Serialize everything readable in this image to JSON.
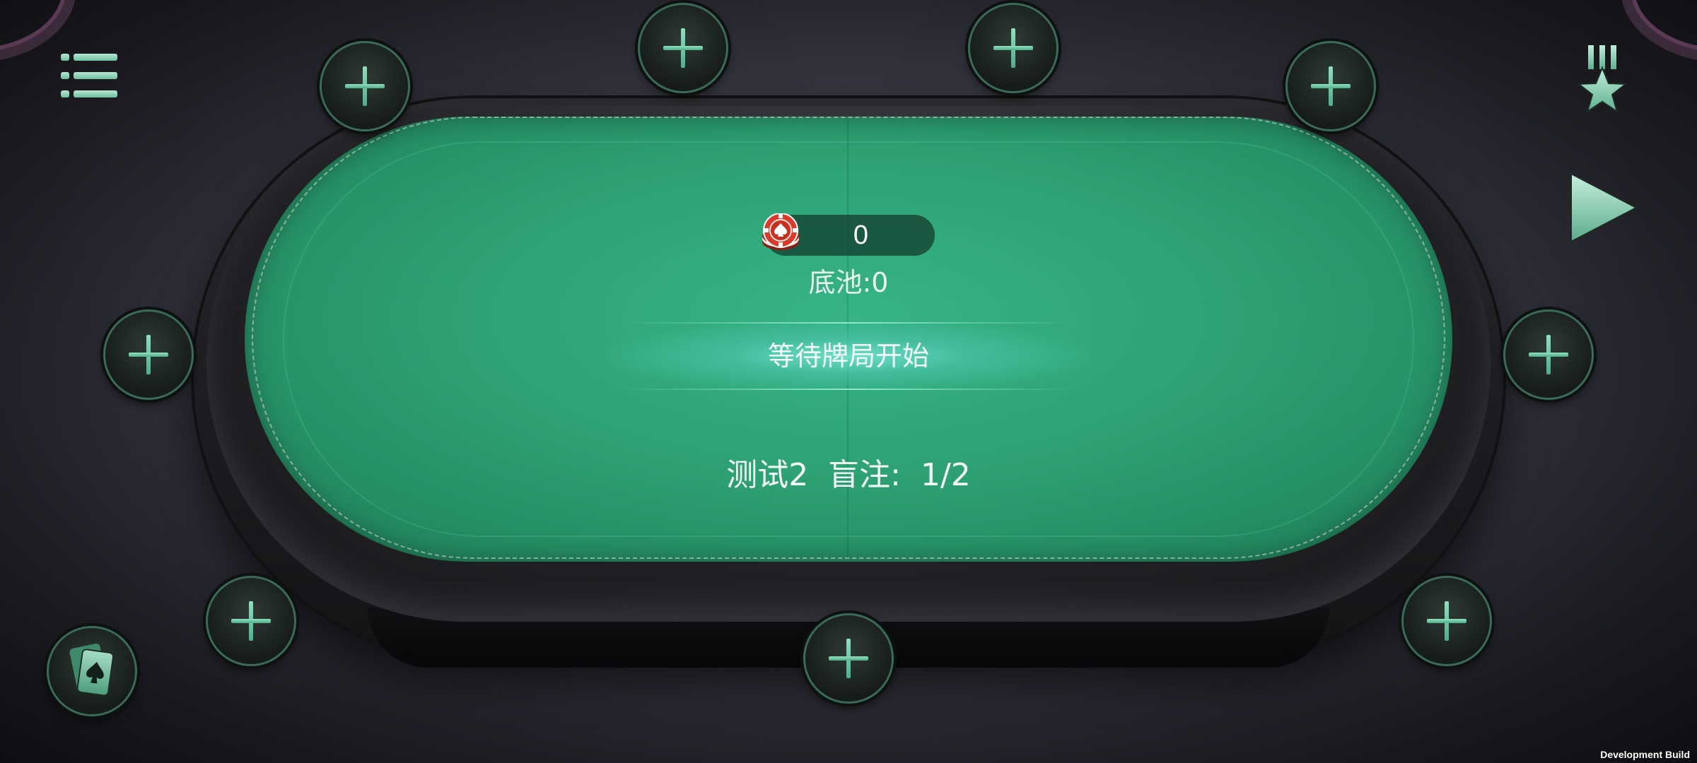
{
  "pot": {
    "chip_amount": "0",
    "pot_label": "底池:0"
  },
  "status": {
    "message": "等待牌局开始"
  },
  "table": {
    "info": "测试2  盲注:  1/2"
  },
  "seats": [
    {
      "icon": "plus-icon",
      "label": "add-seat"
    },
    {
      "icon": "plus-icon",
      "label": "add-seat"
    },
    {
      "icon": "plus-icon",
      "label": "add-seat"
    },
    {
      "icon": "plus-icon",
      "label": "add-seat"
    },
    {
      "icon": "plus-icon",
      "label": "add-seat"
    },
    {
      "icon": "plus-icon",
      "label": "add-seat"
    },
    {
      "icon": "plus-icon",
      "label": "add-seat"
    },
    {
      "icon": "plus-icon",
      "label": "add-seat"
    },
    {
      "icon": "plus-icon",
      "label": "add-seat"
    }
  ],
  "controls": {
    "menu_icon": "menu-list-icon",
    "rank_icon": "rank-star-icon",
    "play_icon": "play-triangle-icon",
    "cards_icon": "spade-cards-icon"
  },
  "footer": {
    "build_label": "Development Build"
  },
  "colors": {
    "felt": "#2ea274",
    "accent": "#6fbfa0",
    "chip": "#d93a2b"
  }
}
